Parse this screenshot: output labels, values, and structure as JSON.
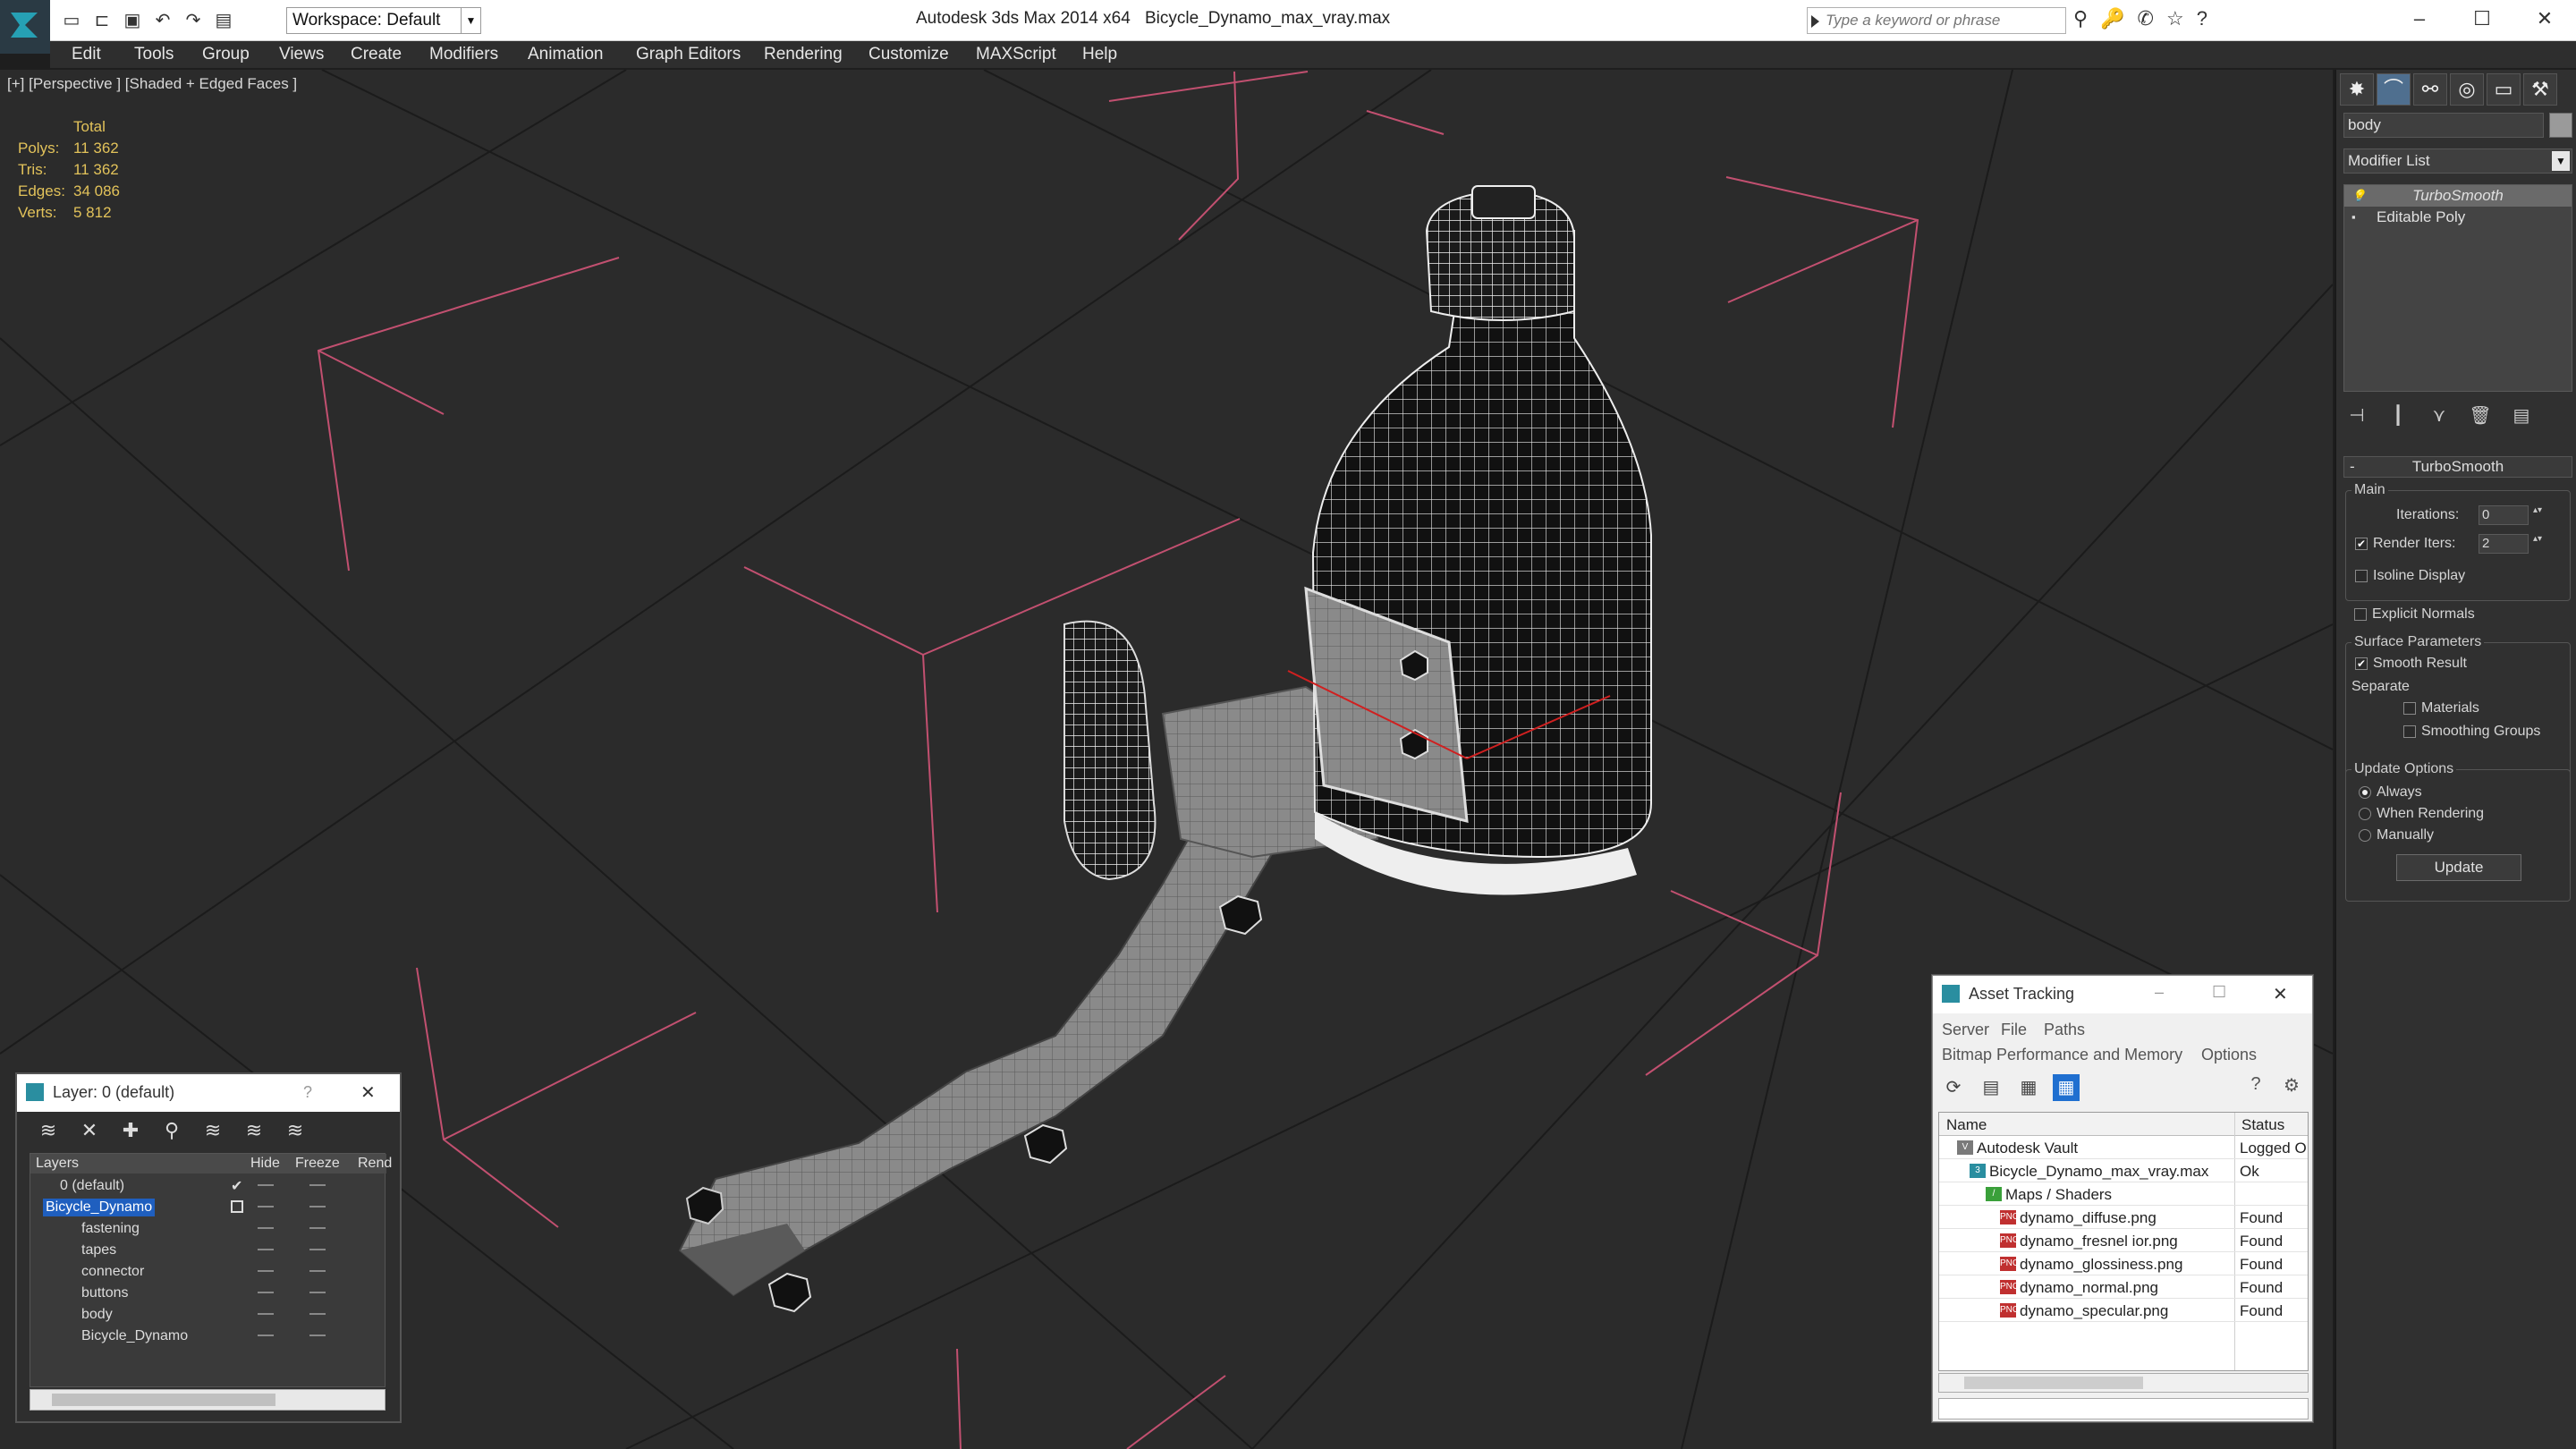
{
  "titlebar": {
    "app": "Autodesk 3ds Max  2014 x64",
    "file": "Bicycle_Dynamo_max_vray.max",
    "workspace": "Workspace: Default",
    "search_placeholder": "Type a keyword or phrase"
  },
  "menu": [
    "Edit",
    "Tools",
    "Group",
    "Views",
    "Create",
    "Modifiers",
    "Animation",
    "Graph Editors",
    "Rendering",
    "Customize",
    "MAXScript",
    "Help"
  ],
  "viewport": {
    "label": "[+] [Perspective ] [Shaded + Edged Faces ]",
    "stats": {
      "header": "Total",
      "rows": [
        {
          "k": "Polys:",
          "v": "11 362"
        },
        {
          "k": "Tris:",
          "v": "11 362"
        },
        {
          "k": "Edges:",
          "v": "34 086"
        },
        {
          "k": "Verts:",
          "v": "5 812"
        }
      ]
    }
  },
  "command_panel": {
    "object_name": "body",
    "modifier_list": "Modifier List",
    "stack": [
      "TurboSmooth",
      "Editable Poly"
    ],
    "rollout_title": "TurboSmooth",
    "main_group": "Main",
    "iterations_label": "Iterations:",
    "iterations_value": "0",
    "render_iters_label": "Render Iters:",
    "render_iters_value": "2",
    "isoline_display": "Isoline Display",
    "explicit_normals": "Explicit Normals",
    "surface_params": "Surface Parameters",
    "smooth_result": "Smooth Result",
    "separate": "Separate",
    "materials": "Materials",
    "smoothing_groups": "Smoothing Groups",
    "update_options": "Update Options",
    "always": "Always",
    "when_rendering": "When Rendering",
    "manually": "Manually",
    "update_button": "Update"
  },
  "layer_window": {
    "title": "Layer: 0 (default)",
    "help": "?",
    "columns": [
      "Layers",
      "Hide",
      "Freeze",
      "Rend"
    ],
    "rows": [
      {
        "name": "0 (default)",
        "indent": 0,
        "selected": false
      },
      {
        "name": "Bicycle_Dynamo",
        "indent": 0,
        "selected": true
      },
      {
        "name": "fastening",
        "indent": 1,
        "selected": false
      },
      {
        "name": "tapes",
        "indent": 1,
        "selected": false
      },
      {
        "name": "connector",
        "indent": 1,
        "selected": false
      },
      {
        "name": "buttons",
        "indent": 1,
        "selected": false
      },
      {
        "name": "body",
        "indent": 1,
        "selected": false
      },
      {
        "name": "Bicycle_Dynamo",
        "indent": 1,
        "selected": false
      }
    ]
  },
  "asset_window": {
    "title": "Asset Tracking",
    "menu_row1": [
      "Server",
      "File",
      "Paths"
    ],
    "menu_row2": [
      "Bitmap Performance and Memory",
      "Options"
    ],
    "columns": [
      "Name",
      "Status"
    ],
    "rows": [
      {
        "name": "Autodesk Vault",
        "status": "Logged O",
        "level": 0,
        "icon": "vault-icon"
      },
      {
        "name": "Bicycle_Dynamo_max_vray.max",
        "status": "Ok",
        "level": 1,
        "icon": "max-file-icon"
      },
      {
        "name": "Maps / Shaders",
        "status": "",
        "level": 2,
        "icon": "maps-icon"
      },
      {
        "name": "dynamo_diffuse.png",
        "status": "Found",
        "level": 3,
        "icon": "png-icon"
      },
      {
        "name": "dynamo_fresnel ior.png",
        "status": "Found",
        "level": 3,
        "icon": "png-icon"
      },
      {
        "name": "dynamo_glossiness.png",
        "status": "Found",
        "level": 3,
        "icon": "png-icon"
      },
      {
        "name": "dynamo_normal.png",
        "status": "Found",
        "level": 3,
        "icon": "png-icon"
      },
      {
        "name": "dynamo_specular.png",
        "status": "Found",
        "level": 3,
        "icon": "png-icon"
      }
    ]
  }
}
